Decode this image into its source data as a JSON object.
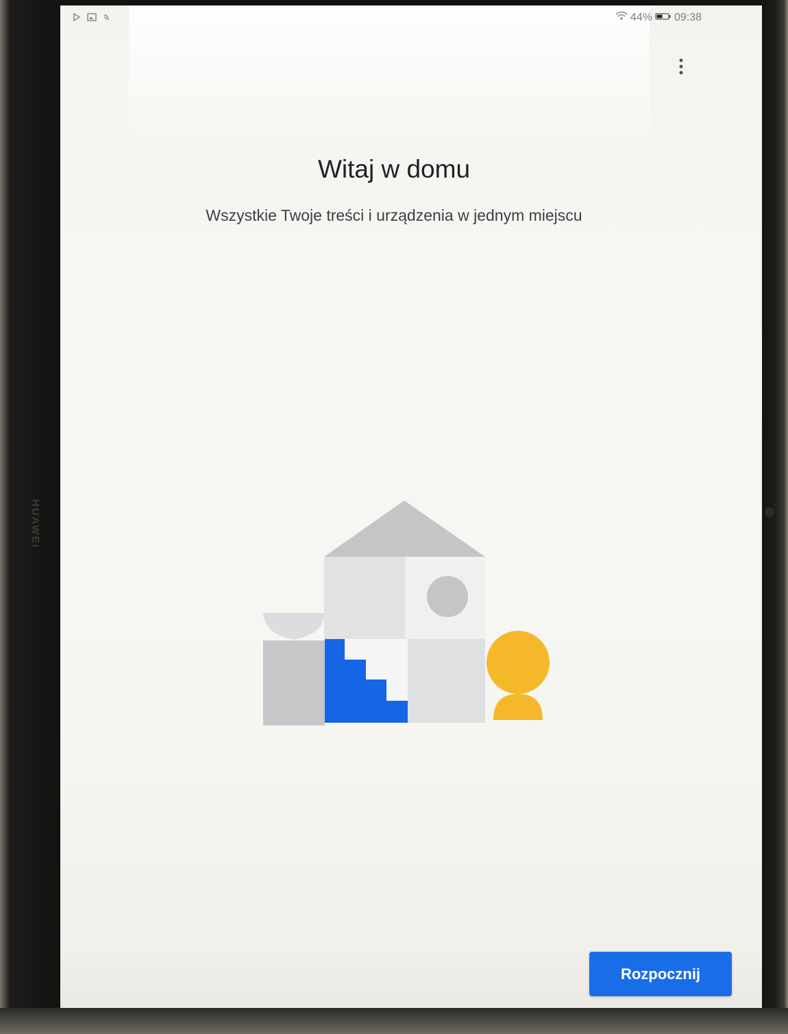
{
  "device": {
    "brand": "HUAWEI"
  },
  "status_bar": {
    "battery_percent": "44%",
    "time": "09:38",
    "icons": [
      "play-store-icon",
      "image-notification-icon",
      "cast-icon",
      "wifi-icon",
      "battery-icon"
    ]
  },
  "screen": {
    "title": "Witaj w domu",
    "subtitle": "Wszystkie Twoje treści i urządzenia w jednym miejscu",
    "more_menu_icon": "more-vertical-icon",
    "primary_button": "Rozpocznij"
  },
  "colors": {
    "accent": "#1a6de8",
    "illustration_blue": "#1565e6",
    "illustration_yellow": "#f5b82a",
    "illustration_gray": "#c4c5c7"
  }
}
